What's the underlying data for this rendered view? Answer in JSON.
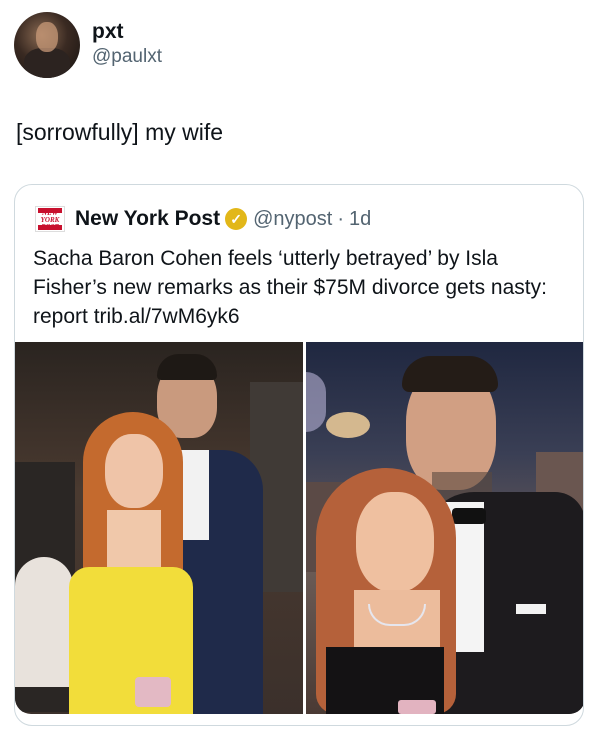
{
  "user": {
    "display_name": "pxt",
    "handle": "@paulxt"
  },
  "tweet": {
    "text": "[sorrowfully] my wife"
  },
  "quoted": {
    "logo_text": "NEW YORK POST",
    "name": "New York Post",
    "handle": "@nypost",
    "separator": "·",
    "time": "1d",
    "text": "Sacha Baron Cohen feels ‘utterly betrayed’ by Isla Fisher’s new remarks as their $75M divorce gets nasty: report trib.al/7wM6yk6"
  },
  "colors": {
    "verified_badge": "#e2b719",
    "nypost_red": "#c8102e",
    "secondary_text": "#536471"
  },
  "icons": {
    "verified": "verified-badge-icon"
  }
}
